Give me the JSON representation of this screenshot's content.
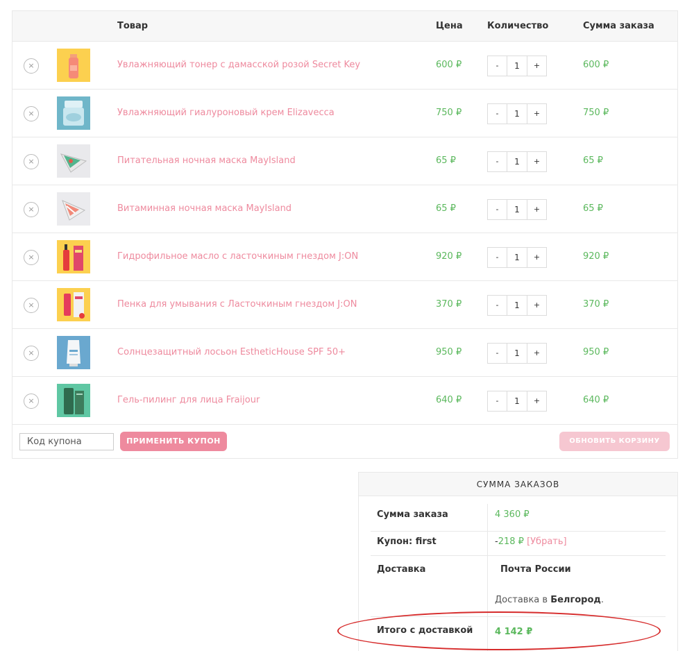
{
  "cart": {
    "headers": {
      "product": "Товар",
      "price": "Цена",
      "quantity": "Количество",
      "subtotal": "Сумма заказа"
    },
    "remove_symbol": "×",
    "qty_minus": "-",
    "qty_plus": "+",
    "items": [
      {
        "name": "Увлажняющий тонер с дамасской розой Secret Key",
        "price": "600 ₽",
        "qty": "1",
        "subtotal": "600 ₽"
      },
      {
        "name": "Увлажняющий гиалуроновый крем Elizavecca",
        "price": "750 ₽",
        "qty": "1",
        "subtotal": "750 ₽"
      },
      {
        "name": "Питательная ночная маска MayIsland",
        "price": "65 ₽",
        "qty": "1",
        "subtotal": "65 ₽"
      },
      {
        "name": "Витаминная ночная маска MayIsland",
        "price": "65 ₽",
        "qty": "1",
        "subtotal": "65 ₽"
      },
      {
        "name": "Гидрофильное масло с ласточкиным гнездом J:ON",
        "price": "920 ₽",
        "qty": "1",
        "subtotal": "920 ₽"
      },
      {
        "name": "Пенка для умывания с Ласточкиным гнездом J:ON",
        "price": "370 ₽",
        "qty": "1",
        "subtotal": "370 ₽"
      },
      {
        "name": "Солнцезащитный лосьон EstheticHouse SPF 50+",
        "price": "950 ₽",
        "qty": "1",
        "subtotal": "950 ₽"
      },
      {
        "name": "Гель-пилинг для лица Fraijour",
        "price": "640 ₽",
        "qty": "1",
        "subtotal": "640 ₽"
      }
    ],
    "coupon_placeholder": "Код купона",
    "apply_coupon": "ПРИМЕНИТЬ КУПОН",
    "update_cart": "ОБНОВИТЬ КОРЗИНУ"
  },
  "totals": {
    "title": "СУММА ЗАКАЗОВ",
    "subtotal_label": "Сумма заказа",
    "subtotal_value": "4 360 ₽",
    "coupon_label": "Купон: first",
    "coupon_minus": "-",
    "coupon_value": "218 ₽",
    "coupon_remove": "[Убрать]",
    "shipping_label": "Доставка",
    "shipping_method": "Почта России",
    "shipping_dest_prefix": "Доставка в ",
    "shipping_city": "Белгород",
    "shipping_dest_suffix": ".",
    "total_label": "Итого с доставкой",
    "total_value": "4 142 ₽"
  },
  "colors": {
    "accent_pink": "#ee8a9e",
    "price_green": "#5bb85d",
    "annotation_red": "#d62b2b"
  }
}
